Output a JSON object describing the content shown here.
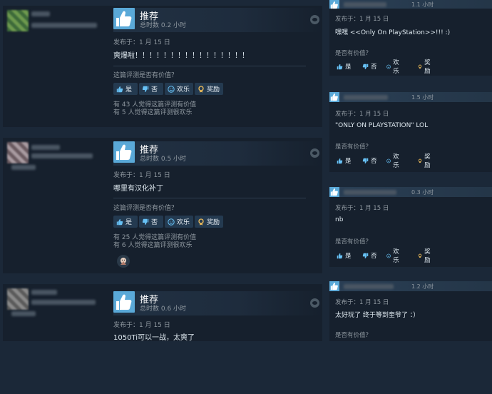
{
  "labels": {
    "recommended": "推荐",
    "helpful_question": "这篇评测是否有价值？",
    "yes": "是",
    "no": "否",
    "funny": "欢乐",
    "award": "奖励",
    "comment_question": "是否有价值？"
  },
  "reviews": [
    {
      "hours": "总时数 0.2 小时",
      "posted": "发布于：1 月 15 日",
      "text": "爽爆啦！！！！！！！！！！！！！！！！",
      "helpful_count": "有 43 人觉得这篇评测有价值",
      "funny_count": "有 5 人觉得这篇评测很欢乐"
    },
    {
      "hours": "总时数 0.5 小时",
      "posted": "发布于：1 月 15 日",
      "text": "哪里有汉化补丁",
      "helpful_count": "有 25 人觉得这篇评测有价值",
      "funny_count": "有 6 人觉得这篇评测很欢乐"
    },
    {
      "hours": "总时数 0.6 小时",
      "posted": "发布于：1 月 15 日",
      "text": "1050Ti可以一战，太爽了"
    }
  ],
  "side_reviews": [
    {
      "hours": "1.1 小时",
      "posted": "发布于：1 月 15 日",
      "text": "嘿嘿 <<Only On PlayStation>>!!! :)"
    },
    {
      "hours": "1.5 小时",
      "posted": "发布于：1 月 15 日",
      "text": "\"ONLY ON PLAYSTATION\" LOL"
    },
    {
      "hours": "0.3 小时",
      "posted": "发布于：1 月 15 日",
      "text": "nb"
    },
    {
      "hours": "1.2 小时",
      "posted": "发布于：1 月 15 日",
      "text": "太好玩了 终于等到奎爷了 ：）"
    }
  ]
}
